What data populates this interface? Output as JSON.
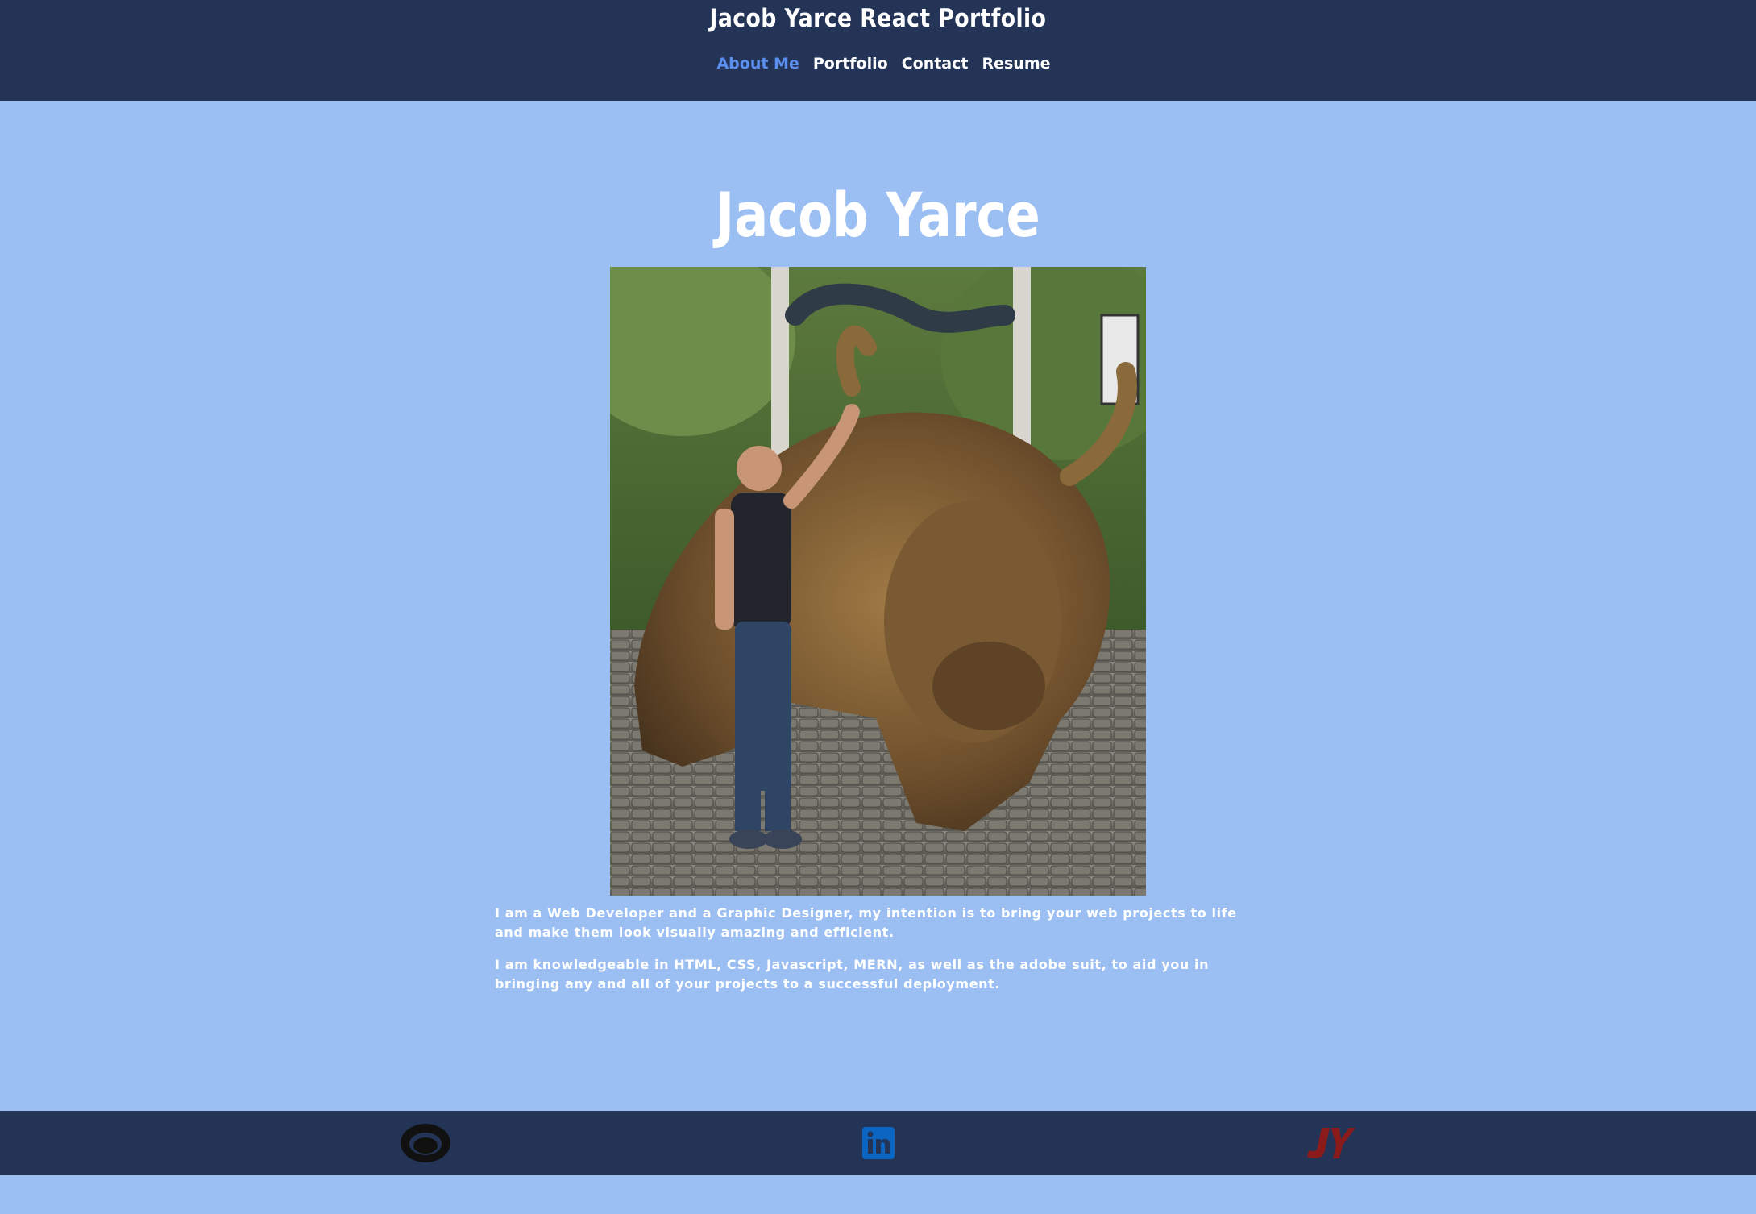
{
  "header": {
    "site_title": "Jacob Yarce React Portfolio",
    "nav": [
      {
        "label": "About Me",
        "active": true
      },
      {
        "label": "Portfolio",
        "active": false
      },
      {
        "label": "Contact",
        "active": false
      },
      {
        "label": "Resume",
        "active": false
      }
    ]
  },
  "main": {
    "name": "Jacob Yarce",
    "bio": [
      "I am a Web Developer and a Graphic Designer, my intention is to bring your web projects to life and make them look visually amazing and efficient.",
      "I am knowledgeable in HTML, CSS, Javascript, MERN, as well as the adobe suit, to aid you in bringing any and all of your projects to a successful deployment."
    ]
  },
  "footer": {
    "links": [
      {
        "icon": "github-icon"
      },
      {
        "icon": "linkedin-icon"
      },
      {
        "icon": "jy-logo-icon"
      }
    ]
  },
  "colors": {
    "header_bg": "#243457",
    "page_bg": "#9bbff2",
    "nav_active": "#5b8ff0",
    "linkedin": "#0a66c2",
    "jy_logo": "#8b1a1a"
  }
}
